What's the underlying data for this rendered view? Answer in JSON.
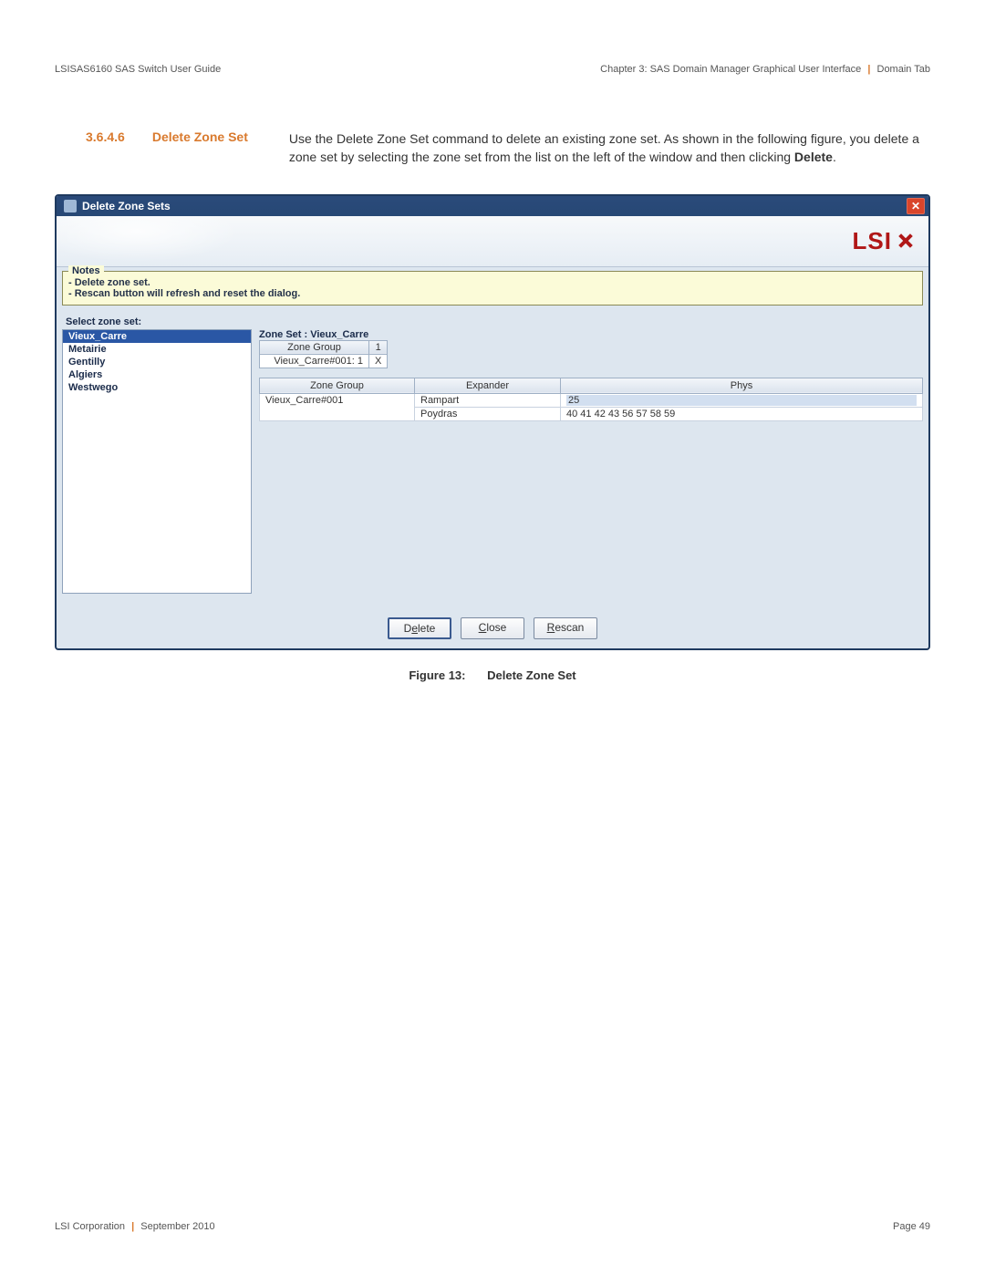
{
  "header": {
    "left": "LSISAS6160 SAS Switch User Guide",
    "right_chapter": "Chapter 3: SAS Domain Manager Graphical User Interface",
    "right_tab": "Domain Tab"
  },
  "section": {
    "number": "3.6.4.6",
    "title": "Delete Zone Set",
    "body_pre": "Use the Delete Zone Set command to delete an existing zone set. As shown in the following figure, you delete a zone set by selecting the zone set from the list on the left of the window and then clicking ",
    "body_bold": "Delete",
    "body_post": "."
  },
  "window": {
    "title": "Delete Zone Sets",
    "logo_text": "LSI",
    "notes": {
      "legend": "Notes",
      "lines": [
        "- Delete zone set.",
        "- Rescan button will refresh and reset the dialog."
      ]
    },
    "select_label": "Select zone set:",
    "zone_sets": [
      "Vieux_Carre",
      "Metairie",
      "Gentilly",
      "Algiers",
      "Westwego"
    ],
    "selected_index": 0,
    "detail": {
      "zs_title": "Zone Set : Vieux_Carre",
      "zg_small": {
        "header_zg": "Zone Group",
        "header_num": "1",
        "row_name": "Vieux_Carre#001: 1",
        "row_x": "X"
      },
      "cols": {
        "zg": "Zone Group",
        "exp": "Expander",
        "phys": "Phys"
      },
      "rows": [
        {
          "zg": "Vieux_Carre#001",
          "exp": "Rampart",
          "phys": "25"
        },
        {
          "zg": "",
          "exp": "Poydras",
          "phys": "40 41 42 43 56 57 58 59"
        }
      ]
    },
    "buttons": {
      "delete_pre": "D",
      "delete_ul": "e",
      "delete_post": "lete",
      "close_ul": "C",
      "close_post": "lose",
      "rescan_ul": "R",
      "rescan_post": "escan"
    }
  },
  "figure": {
    "num": "Figure 13:",
    "title": "Delete Zone Set"
  },
  "footer": {
    "left_a": "LSI Corporation",
    "left_b": "September 2010",
    "right": "Page 49"
  }
}
